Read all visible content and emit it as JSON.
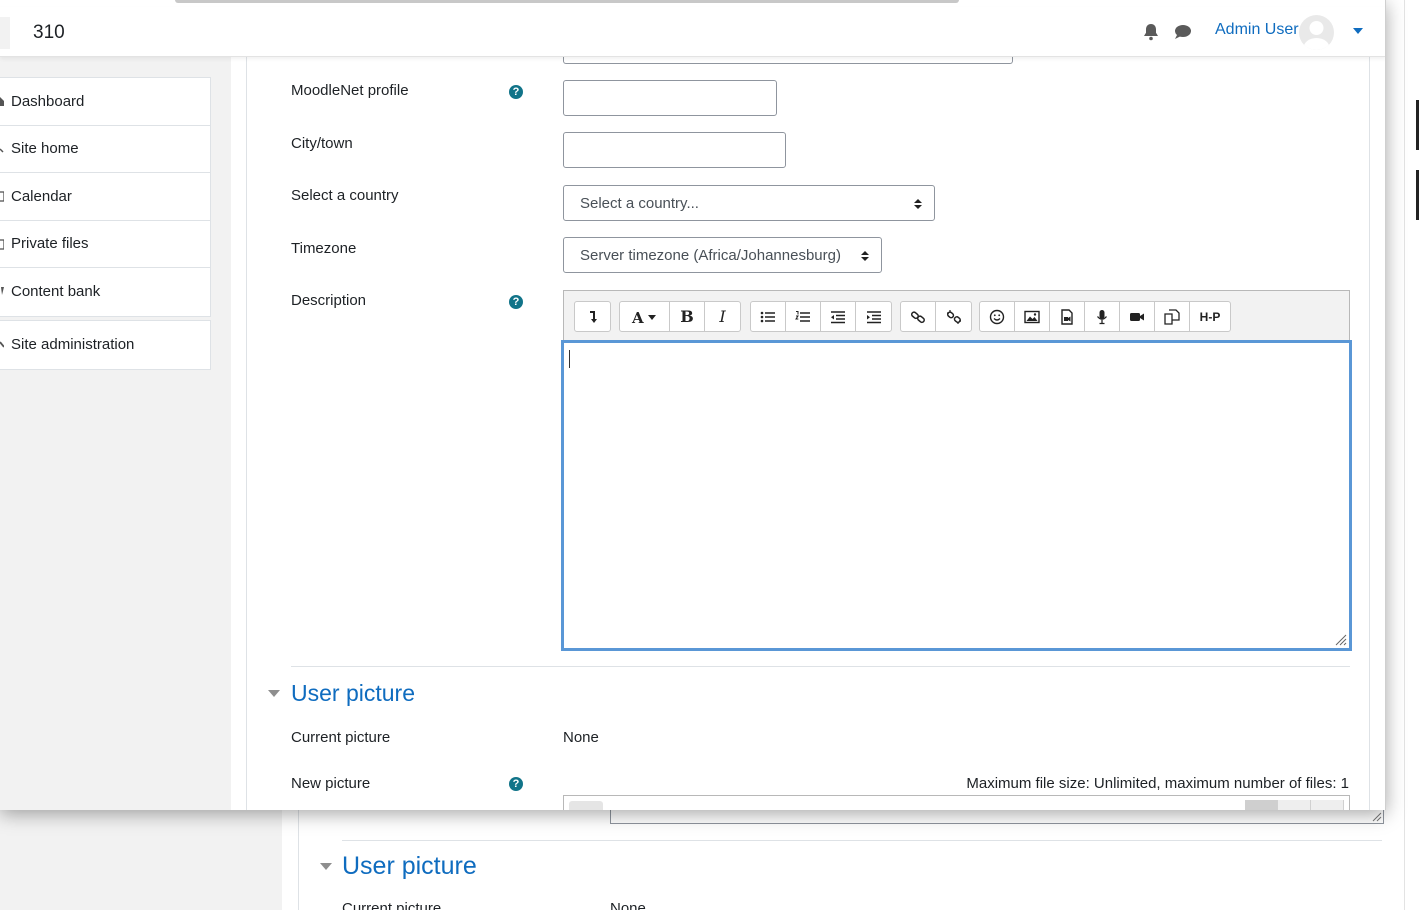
{
  "navbar": {
    "brand": "310",
    "user_name": "Admin User",
    "icons": [
      "bell-icon",
      "chat-icon",
      "avatar",
      "user-menu-caret-icon"
    ]
  },
  "sidebar": {
    "items": [
      {
        "label": "Dashboard",
        "icon": "home-icon"
      },
      {
        "label": "Site home",
        "icon": "sitehome-icon"
      },
      {
        "label": "Calendar",
        "icon": "calendar-icon"
      },
      {
        "label": "Private files",
        "icon": "file-icon"
      },
      {
        "label": "Content bank",
        "icon": "bank-icon"
      }
    ],
    "admin_item": {
      "label": "Site administration",
      "icon": "wrench-icon"
    }
  },
  "form": {
    "moodlenet": {
      "label": "MoodleNet profile",
      "value": ""
    },
    "city": {
      "label": "City/town",
      "value": ""
    },
    "country": {
      "label": "Select a country",
      "selected": "Select a country..."
    },
    "timezone": {
      "label": "Timezone",
      "selected": "Server timezone (Africa/Johannesburg)"
    },
    "description": {
      "label": "Description",
      "toolbar": [
        "collapse-icon",
        "font-style-icon",
        "bold-icon",
        "italic-icon",
        "unordered-list-icon",
        "ordered-list-icon",
        "outdent-icon",
        "indent-icon",
        "link-icon",
        "unlink-icon",
        "emoji-icon",
        "image-icon",
        "media-icon",
        "record-audio-icon",
        "record-video-icon",
        "manage-files-icon",
        "h5p-icon"
      ],
      "bold": "B",
      "italic": "I",
      "h5p": "H-P",
      "value": ""
    }
  },
  "user_picture": {
    "section_title": "User picture",
    "current_picture_label": "Current picture",
    "current_picture_value": "None",
    "new_picture_label": "New picture",
    "file_limit": "Maximum file size: Unlimited, maximum number of files: 1"
  },
  "background": {
    "section_title": "User picture",
    "current_picture_label": "Current picture",
    "current_picture_value": "None"
  },
  "colors": {
    "link": "#0f6cbf",
    "help": "#117489",
    "editor_focus": "#5a97d6",
    "sidebar_bg": "#f2f2f2"
  }
}
